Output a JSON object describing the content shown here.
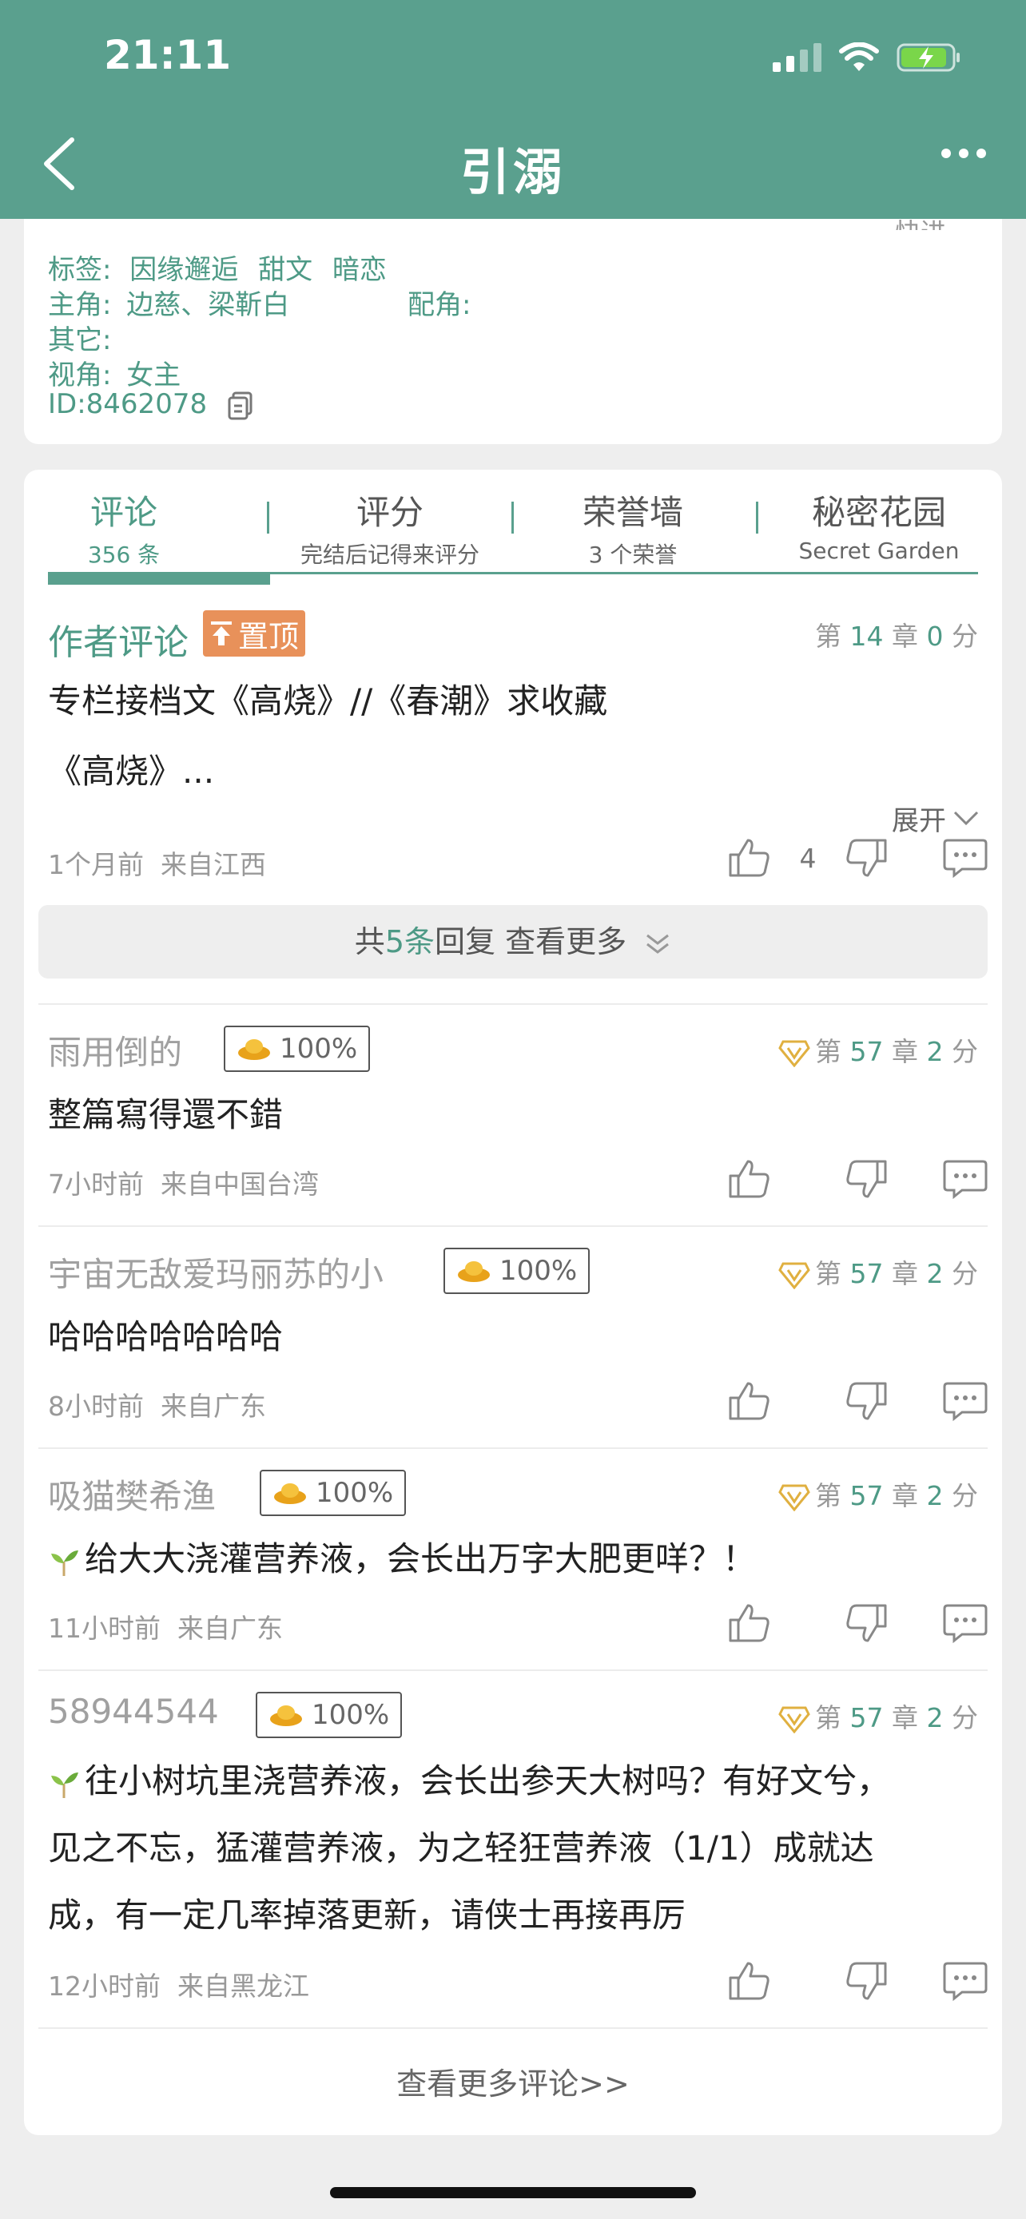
{
  "status_bar": {
    "time": "21:11"
  },
  "nav": {
    "title": "引溺"
  },
  "info": {
    "tags_label": "标签:",
    "tags": [
      "因缘邂逅",
      "甜文",
      "暗恋"
    ],
    "lead_label": "主角:",
    "leads": "边慈、梁靳白",
    "support_label": "配角:",
    "other_label": "其它:",
    "pov_label": "视角:",
    "pov": "女主",
    "id": "ID:8462078"
  },
  "tabs": [
    {
      "label": "评论",
      "sub": "356 条"
    },
    {
      "label": "评分",
      "sub": "完结后记得来评分"
    },
    {
      "label": "荣誉墙",
      "sub": "3 个荣誉"
    },
    {
      "label": "秘密花园",
      "sub": "Secret Garden"
    }
  ],
  "author_comment": {
    "label": "作者评论",
    "pin": "置顶",
    "chapter_prefix": "第",
    "chapter": "14",
    "chapter_suffix": "章",
    "score": "0",
    "score_suffix": "分",
    "line1": "专栏接档文《高烧》//《春潮》求收藏",
    "line2": "《高烧》...",
    "expand": "展开",
    "time": "1个月前",
    "location": "来自江西",
    "likes": "4",
    "replies_prefix": "共",
    "replies_count": "5条",
    "replies_suffix": "回复 查看更多"
  },
  "comments": [
    {
      "user": "雨用倒的",
      "badge": "100%",
      "chapter": "57",
      "score": "2",
      "text": "整篇寫得還不錯",
      "time": "7小时前",
      "location": "来自中国台湾"
    },
    {
      "user": "宇宙无敌爱玛丽苏的小",
      "badge": "100%",
      "chapter": "57",
      "score": "2",
      "text": "哈哈哈哈哈哈哈",
      "time": "8小时前",
      "location": "来自广东"
    },
    {
      "user": "吸猫樊希渔",
      "badge": "100%",
      "chapter": "57",
      "score": "2",
      "text": "给大大浇灌营养液，会长出万字大肥更咩？！",
      "time": "11小时前",
      "location": "来自广东"
    },
    {
      "user": "58944544",
      "badge": "100%",
      "chapter": "57",
      "score": "2",
      "lines": [
        "往小树坑里浇营养液，会长出参天大树吗？有好文兮，",
        "见之不忘，猛灌营养液，为之轻狂营养液（1/1）成就达",
        "成，有一定几率掉落更新，请侠士再接再厉"
      ],
      "time": "12小时前",
      "location": "来自黑龙江"
    }
  ],
  "more_comments": "查看更多评论>>",
  "colors": {
    "header": "#5aa08e",
    "accent": "#4e9a86",
    "pin": "#e8915a"
  }
}
